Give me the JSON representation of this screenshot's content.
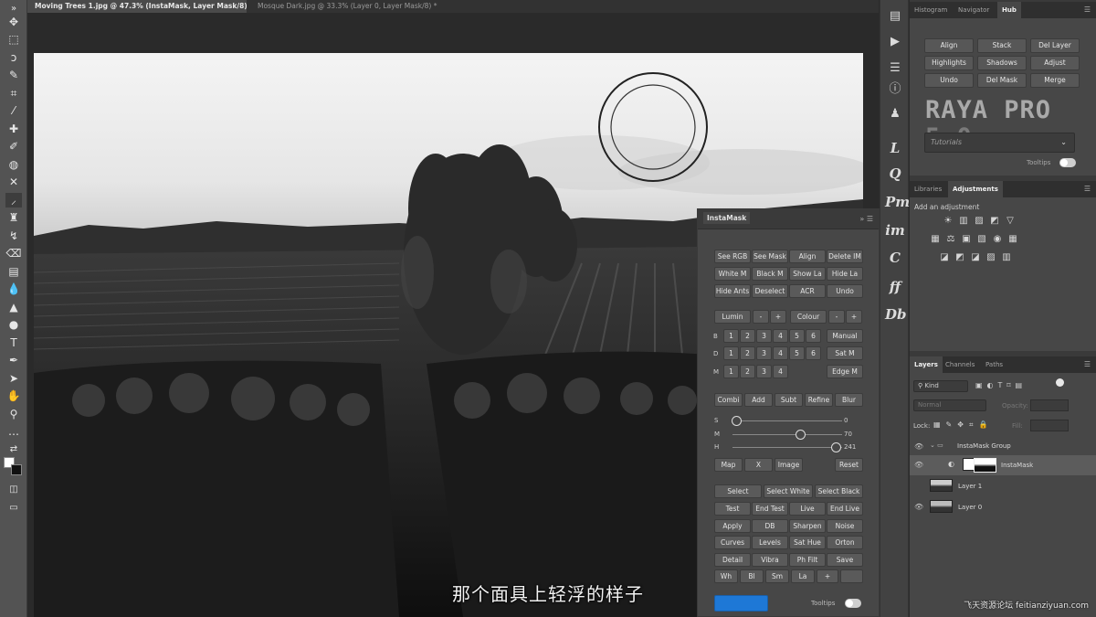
{
  "document_tabs": [
    {
      "label": "Moving Trees 1.jpg @ 47.3% (InstaMask, Layer Mask/8) *",
      "active": true
    },
    {
      "label": "Mosque Dark.jpg @ 33.3% (Layer 0, Layer Mask/8) *",
      "active": false
    }
  ],
  "toolbar_icons": [
    "move-icon",
    "marquee-icon",
    "lasso-icon",
    "quick-select-icon",
    "crop-icon",
    "eyedropper-icon",
    "healing-icon",
    "brush-icon",
    "stamp-icon",
    "history-brush-icon",
    "eraser-icon",
    "gradient-icon",
    "blur-icon",
    "dodge-icon",
    "pen-icon",
    "type-icon",
    "path-select-icon",
    "shape-icon",
    "hand-icon",
    "zoom-icon",
    "more-icon",
    "swap-colors-icon",
    "foreground-background-icon",
    "quick-mask-icon",
    "screen-mode-icon"
  ],
  "instamask": {
    "title": "InstaMask",
    "row1": [
      "See RGB",
      "See Mask",
      "Align",
      "Delete IM"
    ],
    "row2": [
      "White M",
      "Black M",
      "Show La",
      "Hide La"
    ],
    "row3": [
      "Hide Ants",
      "Deselect",
      "ACR",
      "Undo"
    ],
    "lumin": {
      "label": "Lumin",
      "minus": "-",
      "plus": "+"
    },
    "colour": {
      "label": "Colour",
      "minus": "-",
      "plus": "+"
    },
    "b_row": {
      "label": "B",
      "values": [
        "1",
        "2",
        "3",
        "4",
        "5",
        "6"
      ],
      "action": "Manual"
    },
    "d_row": {
      "label": "D",
      "values": [
        "1",
        "2",
        "3",
        "4",
        "5",
        "6"
      ],
      "action": "Sat M"
    },
    "m_row": {
      "label": "M",
      "values": [
        "1",
        "2",
        "3",
        "4"
      ],
      "action": "Edge M"
    },
    "combine_row": [
      "Combi",
      "Add",
      "Subt",
      "Refine",
      "Blur"
    ],
    "sliders": [
      {
        "label": "S",
        "value": "0",
        "position": 0.03
      },
      {
        "label": "M",
        "value": "70",
        "position": 0.62
      },
      {
        "label": "H",
        "value": "241",
        "position": 0.94
      }
    ],
    "map_row": [
      "Map",
      "X",
      "Image"
    ],
    "reset": "Reset",
    "select_row": [
      "Select",
      "Select White",
      "Select Black"
    ],
    "test_row": [
      "Test",
      "End Test",
      "Live",
      "End Live"
    ],
    "apply_row": [
      "Apply",
      "DB",
      "Sharpen",
      "Noise"
    ],
    "curves_row": [
      "Curves",
      "Levels",
      "Sat Hue",
      "Orton"
    ],
    "detail_row": [
      "Detail",
      "Vibra",
      "Ph Filt",
      "Save"
    ],
    "wh_row": [
      "Wh",
      "Bl",
      "Sm",
      "La",
      "+",
      ""
    ],
    "tooltips": "Tooltips",
    "tooltips_on": true
  },
  "icon_strip": [
    {
      "name": "play-icon",
      "glyph": "▶"
    },
    {
      "name": "adjust-icon",
      "glyph": "☰"
    },
    {
      "name": "info-icon",
      "glyph": "ⓘ"
    },
    {
      "name": "person-icon",
      "glyph": "♟"
    },
    {
      "name": "raya-l-icon",
      "glyph": "L"
    },
    {
      "name": "raya-q-icon",
      "glyph": "Q"
    },
    {
      "name": "raya-pm-icon",
      "glyph": "Pm"
    },
    {
      "name": "raya-im-icon",
      "glyph": "im"
    },
    {
      "name": "raya-c-icon",
      "glyph": "C"
    },
    {
      "name": "raya-ff-icon",
      "glyph": "ff"
    },
    {
      "name": "raya-db-icon",
      "glyph": "Db"
    }
  ],
  "hub_panel": {
    "tabs": [
      "Histogram",
      "Navigator",
      "Hub"
    ],
    "active_tab": "Hub",
    "buttons": [
      [
        "Align",
        "Stack",
        "Del Layer"
      ],
      [
        "Highlights",
        "Shadows",
        "Adjust"
      ],
      [
        "Undo",
        "Del Mask",
        "Merge"
      ]
    ],
    "logo": "RAYA PRO",
    "logo_version": "5.0",
    "dropdown": "Tutorials",
    "tooltips": "Tooltips"
  },
  "adjustments_panel": {
    "tabs": [
      "Libraries",
      "Adjustments"
    ],
    "active_tab": "Adjustments",
    "hint": "Add an adjustment"
  },
  "layers_panel": {
    "tabs": [
      "Layers",
      "Channels",
      "Paths"
    ],
    "active_tab": "Layers",
    "filter_kind": "Kind",
    "blend_mode": "Normal",
    "opacity_label": "Opacity:",
    "lock_label": "Lock:",
    "fill_label": "Fill:",
    "layers": [
      {
        "name": "InstaMask Group",
        "type": "group"
      },
      {
        "name": "InstaMask",
        "type": "adjustment",
        "selected": true
      },
      {
        "name": "Layer 1",
        "type": "pixel"
      },
      {
        "name": "Layer 0",
        "type": "pixel"
      }
    ]
  },
  "subtitle": "那个面具上轻浮的样子",
  "watermark": "飞天资源论坛 feitianziyuan.com"
}
